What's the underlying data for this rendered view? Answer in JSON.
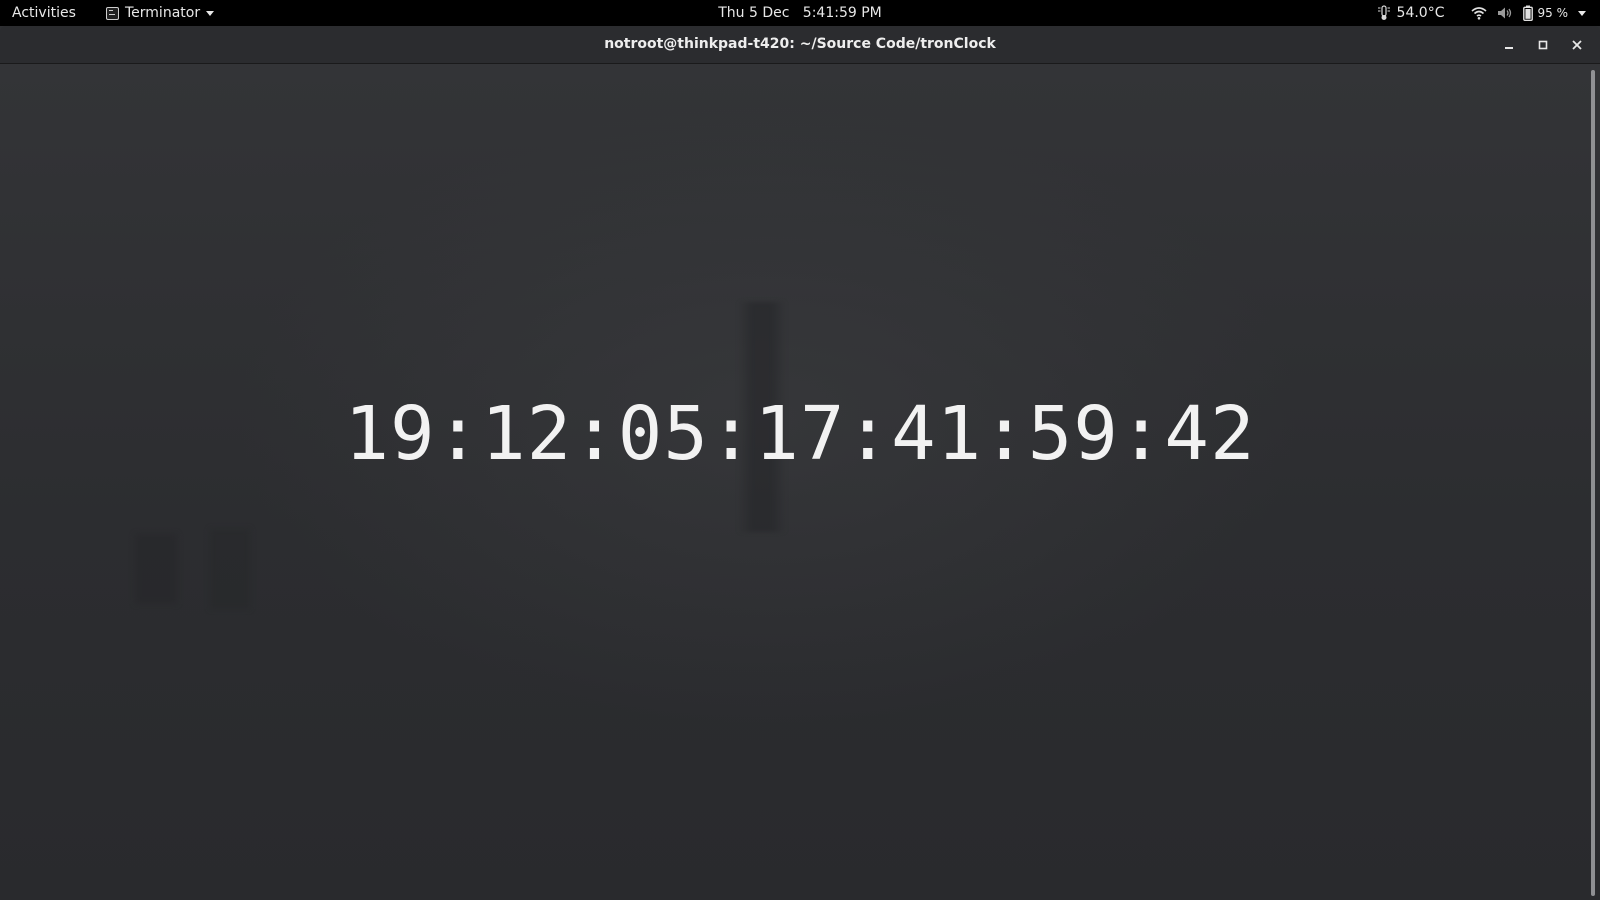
{
  "topbar": {
    "activities_label": "Activities",
    "app_name": "Terminator",
    "datetime": "Thu 5 Dec   5:41:59 PM",
    "temperature": "54.0°C",
    "battery_percent": "95 %"
  },
  "window": {
    "title": "notroot@thinkpad-t420: ~/Source Code/tronClock"
  },
  "terminal": {
    "clock_text": "19:12:05:17:41:59:42"
  },
  "icons": {
    "app": "terminal-icon",
    "thermometer": "thermometer-icon",
    "wifi": "wifi-icon",
    "volume": "volume-icon",
    "battery": "battery-icon",
    "minimize": "minimize-icon",
    "maximize": "maximize-icon",
    "close": "close-icon"
  },
  "colors": {
    "topbar_bg": "#000000",
    "titlebar_bg": "#2b2c2f",
    "terminal_bg": "#2d2e31",
    "clock_text": "#f2f2f2"
  }
}
